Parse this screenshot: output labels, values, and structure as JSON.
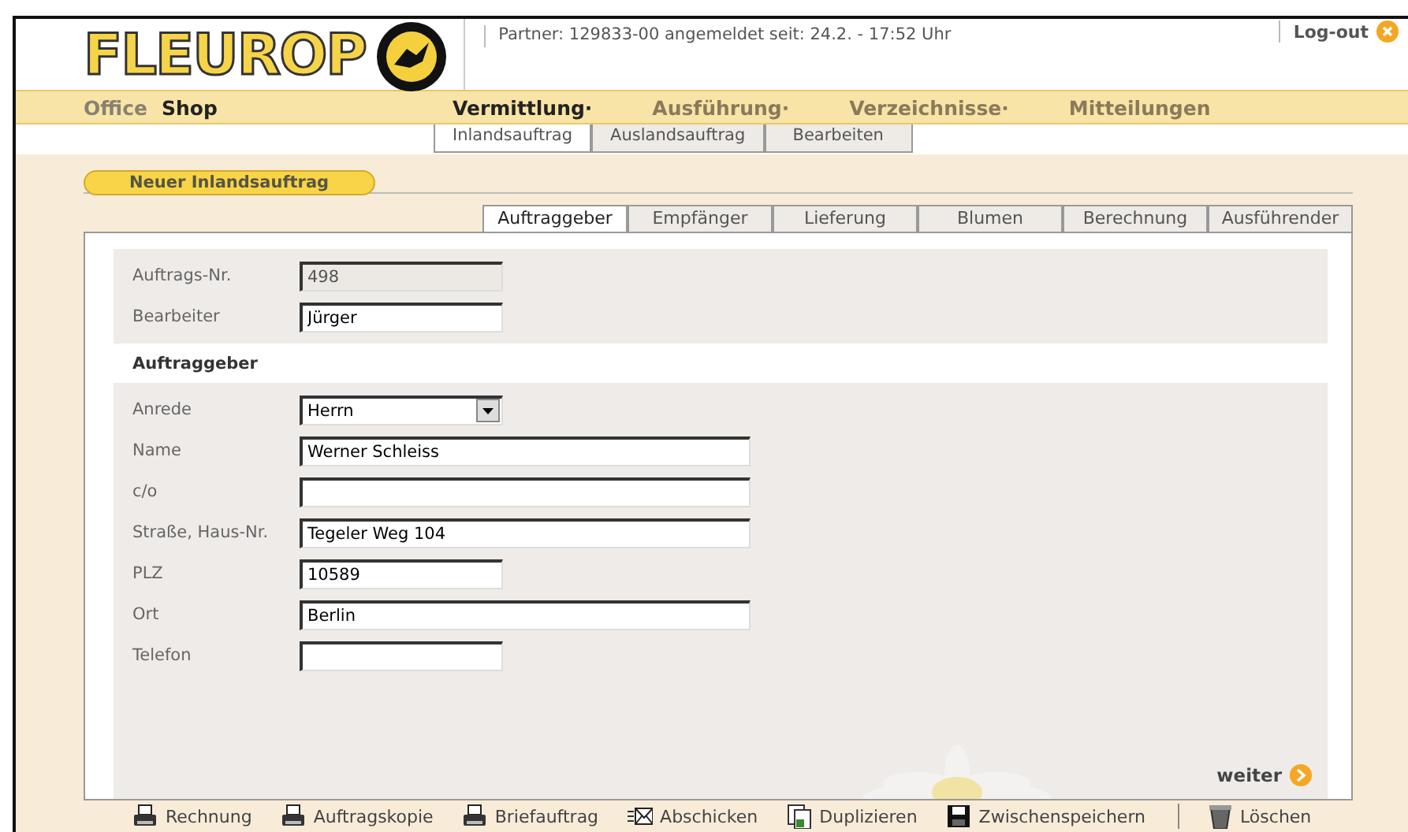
{
  "header": {
    "logo": "FLEUROP",
    "partner_info": "Partner: 129833-00 angemeldet seit: 24.2. - 17:52 Uhr",
    "logout": "Log-out"
  },
  "nav": {
    "areas": [
      {
        "label": "Office",
        "selected": false
      },
      {
        "label": "Shop",
        "selected": true
      }
    ],
    "menus": [
      {
        "label": "Vermittlung·",
        "selected": true
      },
      {
        "label": "Ausführung·",
        "selected": false
      },
      {
        "label": "Verzeichnisse·",
        "selected": false
      },
      {
        "label": "Mitteilungen",
        "selected": false
      }
    ]
  },
  "subtabs": [
    {
      "label": "Inlandsauftrag",
      "selected": true
    },
    {
      "label": "Auslandsauftrag",
      "selected": false
    },
    {
      "label": "Bearbeiten",
      "selected": false
    }
  ],
  "section_title": "Neuer Inlandsauftrag",
  "tabs": [
    {
      "label": "Auftraggeber",
      "selected": true
    },
    {
      "label": "Empfänger",
      "selected": false
    },
    {
      "label": "Lieferung",
      "selected": false
    },
    {
      "label": "Blumen",
      "selected": false
    },
    {
      "label": "Berechnung",
      "selected": false
    },
    {
      "label": "Ausführender",
      "selected": false
    }
  ],
  "form": {
    "top_fields": [
      {
        "label": "Auftrags-Nr.",
        "value": "498",
        "kind": "short",
        "disabled": true
      },
      {
        "label": "Bearbeiter",
        "value": "Jürger",
        "kind": "short",
        "disabled": false
      }
    ],
    "group_title": "Auftraggeber",
    "fields": [
      {
        "label": "Anrede",
        "value": "Herrn",
        "kind": "select",
        "disabled": false
      },
      {
        "label": "Name",
        "value": "Werner Schleiss",
        "kind": "long",
        "disabled": false
      },
      {
        "label": "c/o",
        "kind": "long",
        "disabled": false
      },
      {
        "label": "Straße, Haus-Nr.",
        "value": "Tegeler Weg 104",
        "kind": "long",
        "disabled": false
      },
      {
        "label": "PLZ",
        "value": "10589",
        "kind": "short",
        "disabled": false
      },
      {
        "label": "Ort",
        "value": "Berlin",
        "kind": "long",
        "disabled": false
      },
      {
        "label": "Telefon",
        "kind": "short",
        "disabled": false
      }
    ]
  },
  "next_button": "weiter",
  "toolbar": [
    {
      "label": "Rechnung",
      "kind": "printer",
      "separated": false
    },
    {
      "label": "Auftragskopie",
      "kind": "printer",
      "separated": false
    },
    {
      "label": "Briefauftrag",
      "kind": "printer",
      "separated": false
    },
    {
      "label": "Abschicken",
      "kind": "envelope",
      "separated": false
    },
    {
      "label": "Duplizieren",
      "kind": "duplicate",
      "separated": false
    },
    {
      "label": "Zwischenspeichern",
      "kind": "floppy",
      "separated": false
    },
    {
      "label": "Löschen",
      "kind": "trash",
      "separated": true
    }
  ]
}
